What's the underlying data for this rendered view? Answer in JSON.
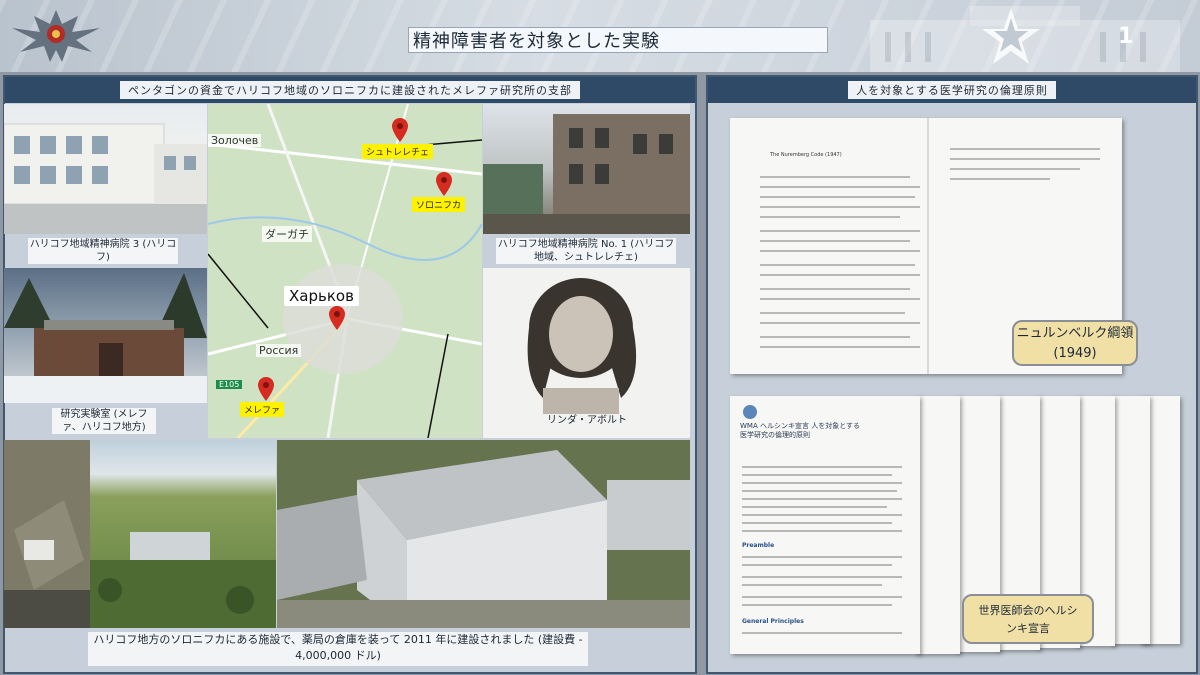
{
  "header": {
    "title": "精神障害者を対象とした実験",
    "slide_number": "1"
  },
  "left_panel": {
    "heading": "ペンタゴンの資金でハリコフ地域のソロニフカに建設されたメレファ研究所の支部",
    "captions": {
      "hospital3": "ハリコフ地域精神病院 3 (ハリコフ)",
      "hospital1": "ハリコフ地域精神病院 No. 1 (ハリコフ地域、シュトレレチェ)",
      "research_lab": "研究実験室 (メレファ、ハリコフ地方)",
      "linda": "リンダ・アボルト"
    },
    "map": {
      "labels": {
        "zolochev": "Золочев",
        "dergachi": "ダーガチ",
        "kharkov": "Харьков",
        "russia": "Россия",
        "road": "E105"
      },
      "tags": {
        "shtrelechye": "シュトレレチェ",
        "solonivka": "ソロニフカ",
        "merefa": "メレファ"
      }
    },
    "bottom_caption": "ハリコフ地方のソロニフカにある施設で、薬局の倉庫を装って 2011 年に建設されました (建設費 - 4,000,000 ドル)"
  },
  "right_panel": {
    "heading": "人を対象とする医学研究の倫理原則",
    "nuremberg_doc_title": "The Nuremberg Code (1947)",
    "nuremberg_callout": "ニュルンベルク綱領 (1949)",
    "helsinki_doc_heading": "WMA ヘルシンキ宣言 人を対象とする医学研究の倫理的原則",
    "helsinki_doc_sections": [
      "Preamble",
      "General Principles"
    ],
    "helsinki_callout": "世界医師会のヘルシンキ宣言"
  },
  "colors": {
    "panel_border": "#3f5770",
    "panel_head": "#2f4a67",
    "callout_fill": "#f1e0a6",
    "tag_yellow": "#fff200",
    "pin_red": "#d62b20"
  }
}
